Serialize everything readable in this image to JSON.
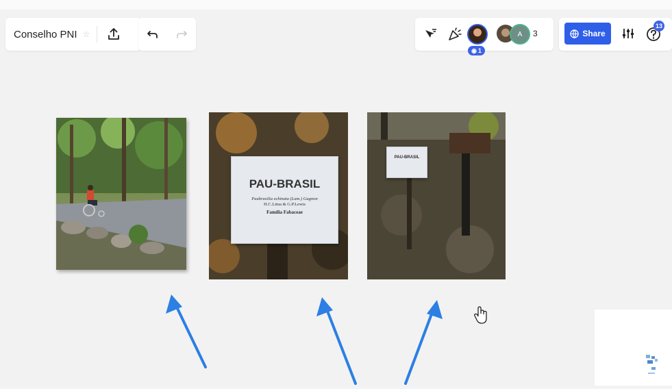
{
  "toolbar": {
    "board_name": "Conselho PNI",
    "share_label": "Share",
    "collaborator_count": "3",
    "viewer_count": "1",
    "help_badge": "13",
    "avatar_initial": "A"
  },
  "photos": [
    {
      "sign_title": "",
      "sign_lines": []
    },
    {
      "sign_title": "PAU-BRASIL",
      "sign_lines": [
        "Paubrasilia echinata (Lam.) Gagnon",
        "H.C.Lima & G.P.Lewis",
        "Família Fabaceae"
      ]
    },
    {
      "sign_title": "PAU-BRASIL",
      "sign_lines": []
    }
  ],
  "colors": {
    "accent": "#2f5fe8",
    "arrow": "#2c7fe3",
    "canvas": "#f2f2f3"
  },
  "icons": [
    "star-icon",
    "export-icon",
    "undo-icon",
    "redo-icon",
    "cursor-filter-icon",
    "celebrate-icon",
    "eye-icon",
    "globe-icon",
    "settings-sliders-icon",
    "help-icon",
    "hand-cursor-icon"
  ]
}
